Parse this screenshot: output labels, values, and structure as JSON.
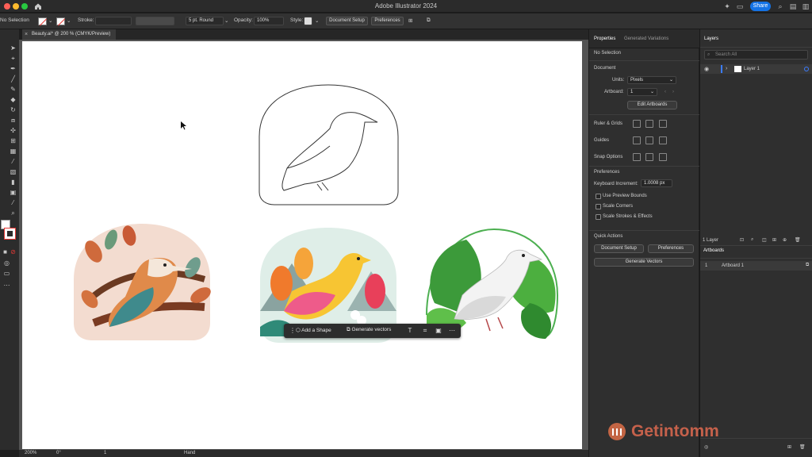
{
  "app": {
    "title": "Adobe Illustrator 2024",
    "share_label": "Share"
  },
  "control_bar": {
    "selection_label": "No Selection",
    "stroke_label": "Stroke:",
    "brush_label": "5 pt. Round",
    "opacity_label": "Opacity:",
    "opacity_value": "100%",
    "style_label": "Style:",
    "document_setup_label": "Document Setup",
    "preferences_label": "Preferences"
  },
  "document_tab": {
    "title": "Beauty.ai* @ 200 % (CMYK/Preview)"
  },
  "context_bar": {
    "add_shape_label": "Add a Shape",
    "generate_vectors_label": "Generate vectors"
  },
  "status_bar": {
    "zoom": "200%",
    "rotation": "0°",
    "artboard_number": "1",
    "tool": "Hand"
  },
  "properties": {
    "tabs": [
      {
        "label": "Properties"
      },
      {
        "label": "Generated Variations"
      }
    ],
    "selection_state": "No Selection",
    "document_heading": "Document",
    "units_label": "Units:",
    "units_value": "Pixels",
    "artboard_label": "Artboard:",
    "artboard_value": "1",
    "edit_artboards_label": "Edit Artboards",
    "ruler_grids_label": "Ruler & Grids",
    "guides_label": "Guides",
    "snap_options_label": "Snap Options",
    "preferences_heading": "Preferences",
    "keyboard_increment_label": "Keyboard Increment:",
    "keyboard_increment_value": "1.0008 px",
    "checkboxes": [
      {
        "label": "Use Preview Bounds",
        "checked": false
      },
      {
        "label": "Scale Corners",
        "checked": false
      },
      {
        "label": "Scale Strokes & Effects",
        "checked": false
      }
    ],
    "quick_actions_heading": "Quick Actions",
    "document_setup_label": "Document Setup",
    "preferences_button_label": "Preferences",
    "generate_vectors_label": "Generate Vectors"
  },
  "layers": {
    "tab_label": "Layers",
    "search_placeholder": "Search All",
    "layer_name": "Layer 1",
    "layer_count": "1 Layer",
    "artboards_tab_label": "Artboards",
    "artboard_index": "1",
    "artboard_name": "Artboard 1"
  },
  "watermark": {
    "text": "Getintomm"
  },
  "colors": {
    "accent": "#1473e6",
    "panel_bg": "#2f2f2f",
    "artboard": "#ffffff",
    "layer_color": "#3b7cff"
  }
}
